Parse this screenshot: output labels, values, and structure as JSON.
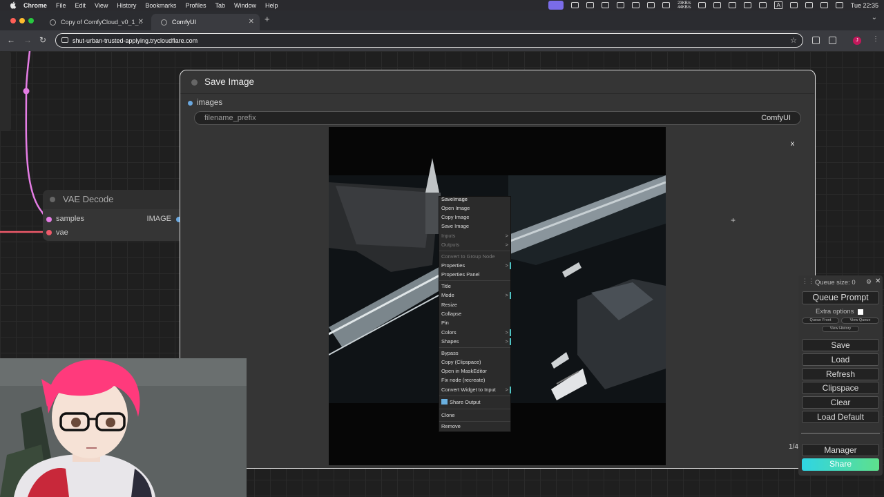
{
  "menubar": {
    "app": "Chrome",
    "items": [
      "File",
      "Edit",
      "View",
      "History",
      "Bookmarks",
      "Profiles",
      "Tab",
      "Window",
      "Help"
    ],
    "net_up": "23KB/s",
    "net_down": "44KB/s",
    "clock": "Tue 22:35",
    "keyboard": "A"
  },
  "tabs": [
    {
      "title": "Copy of ComfyCloud_v0_1_...",
      "active": false
    },
    {
      "title": "ComfyUI",
      "active": true
    }
  ],
  "address": {
    "url": "shut-urban-trusted-applying.trycloudflare.com",
    "profile_initial": "J"
  },
  "vae_node": {
    "title": "VAE Decode",
    "inputs": [
      "samples",
      "vae"
    ],
    "output": "IMAGE"
  },
  "save_node": {
    "title": "Save Image",
    "input": "images",
    "widget_label": "filename_prefix",
    "widget_value": "ComfyUI",
    "close": "x",
    "page_indicator": "1/4"
  },
  "context_menu": {
    "title": "SaveImage",
    "items": [
      {
        "label": "Open Image"
      },
      {
        "label": "Copy Image"
      },
      {
        "label": "Save Image"
      },
      {
        "label": "Inputs",
        "disabled": true,
        "submenu": true
      },
      {
        "label": "Outputs",
        "disabled": true,
        "submenu": true
      },
      {
        "label": "Convert to Group Node",
        "disabled": true
      },
      {
        "label": "Properties",
        "submenu": true
      },
      {
        "label": "Properties Panel"
      },
      {
        "label": "Title"
      },
      {
        "label": "Mode",
        "submenu": true
      },
      {
        "label": "Resize"
      },
      {
        "label": "Collapse"
      },
      {
        "label": "Pin"
      },
      {
        "label": "Colors",
        "submenu": true
      },
      {
        "label": "Shapes",
        "submenu": true
      },
      {
        "label": "Bypass"
      },
      {
        "label": "Copy (Clipspace)"
      },
      {
        "label": "Open in MaskEditor"
      },
      {
        "label": "Fix node (recreate)"
      },
      {
        "label": "Convert Widget to Input",
        "submenu": true
      },
      {
        "label": "Share Output",
        "icon": "share-output-icon"
      },
      {
        "label": "Clone"
      },
      {
        "label": "Remove"
      }
    ]
  },
  "queue_panel": {
    "queue_size": "Queue size: 0",
    "queue_prompt": "Queue Prompt",
    "extra_options": "Extra options",
    "queue_front": "Queue Front",
    "view_queue": "View Queue",
    "view_history": "View History",
    "buttons": [
      "Save",
      "Load",
      "Refresh",
      "Clipspace",
      "Clear",
      "Load Default"
    ],
    "manager": "Manager",
    "share": "Share"
  },
  "colors": {
    "canvas_bg": "#1f1f1f",
    "node_bg": "#353535",
    "wire_pink": "#e57de5",
    "wire_red": "#ef5a6a",
    "link_blue": "#6aa8e0",
    "accent_teal": "#4fc3c3",
    "share_gradient_start": "#2fd4e4",
    "share_gradient_end": "#5ee08c"
  }
}
